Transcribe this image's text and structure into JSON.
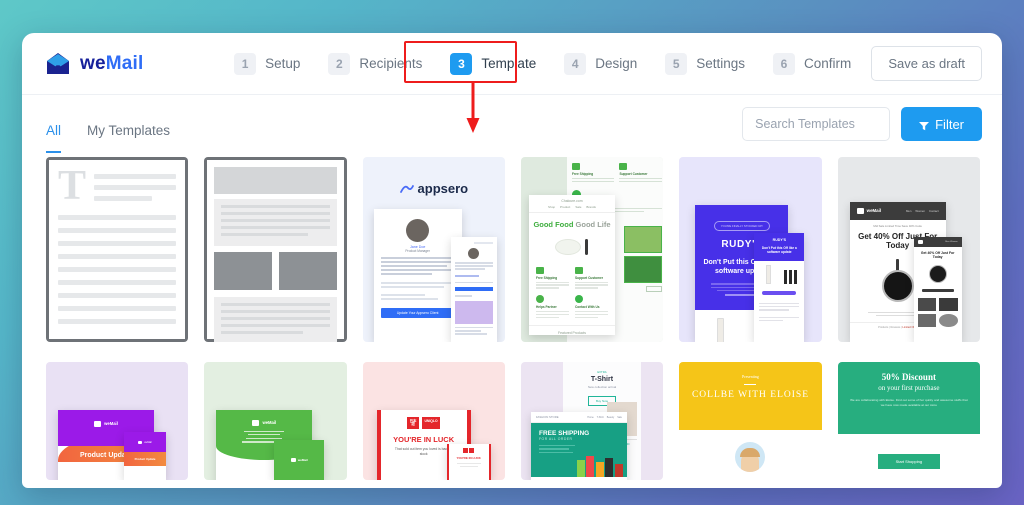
{
  "brand": {
    "name_we": "we",
    "name_mail": "Mail",
    "logo_icon": "envelope-icon"
  },
  "header": {
    "steps": [
      {
        "num": "1",
        "label": "Setup",
        "active": false
      },
      {
        "num": "2",
        "label": "Recipients",
        "active": false
      },
      {
        "num": "3",
        "label": "Template",
        "active": true
      },
      {
        "num": "4",
        "label": "Design",
        "active": false
      },
      {
        "num": "5",
        "label": "Settings",
        "active": false
      },
      {
        "num": "6",
        "label": "Confirm",
        "active": false
      }
    ],
    "save_draft_label": "Save as draft"
  },
  "toolbar": {
    "tabs": [
      {
        "label": "All",
        "active": true
      },
      {
        "label": "My Templates",
        "active": false
      }
    ],
    "search_placeholder": "Search Templates",
    "search_value": "",
    "filter_label": "Filter",
    "filter_icon": "funnel-icon"
  },
  "annotation": {
    "target_step": "Template",
    "box_color": "#ee1c1c",
    "arrow_icon": "down-arrow-icon"
  },
  "templates": {
    "row1": [
      {
        "id": "blank-text",
        "kind": "wireframe-text",
        "letter": "T"
      },
      {
        "id": "basic-layout",
        "kind": "wireframe-layout"
      },
      {
        "id": "appsero",
        "kind": "preview",
        "brand": "appsero",
        "person_name": "Jane Doe",
        "person_role": "Product Manager",
        "cta": "Update Your Appsero Client",
        "bg": "#eef2fb"
      },
      {
        "id": "good-food",
        "kind": "preview",
        "headline_a": "Good Food",
        "headline_b": "Good Life",
        "features": [
          "Free Shipping",
          "Support Customer",
          "Helps Partner",
          "Contact With Us"
        ],
        "section": "Featured Products",
        "footer": "Featured Products",
        "bg": "#dfeadf"
      },
      {
        "id": "rudys",
        "kind": "preview",
        "brand": "RUDY'S",
        "eyebrow": "YOU'RE FINALLY STOCKED UP!",
        "headline": "Don't Put this Off like a software update",
        "bg": "#e7e5fb"
      },
      {
        "id": "watch-sale",
        "kind": "preview",
        "brand": "weMail",
        "strip": "Mid Sale Limited Time Save 40% Code",
        "headline": "Get 40% Off Just For Today",
        "nav": [
          "Men",
          "Women",
          "Contact"
        ],
        "bg": "#e6e8ea"
      }
    ],
    "row2": [
      {
        "id": "product-update",
        "kind": "preview",
        "brand": "weMail",
        "headline": "Product Update",
        "bg": "#e9e1f4"
      },
      {
        "id": "green-card",
        "kind": "preview",
        "brand": "weMail",
        "bg": "#e3efe1"
      },
      {
        "id": "uniqlo-luck",
        "kind": "preview",
        "brand": "UNIQLO",
        "headline": "YOU'RE IN LUCK",
        "sub": "That sold out item you loved is back in stock",
        "bg": "#fbe3e3"
      },
      {
        "id": "free-shipping",
        "kind": "preview",
        "headline": "FREE SHIPPING",
        "sub": "FOR ALL ORDER",
        "side_title": "T-Shirt",
        "side_sub": "New collection arrival",
        "side_cta": "Buy Now",
        "bg": "#ece4f2"
      },
      {
        "id": "collbe-eloise",
        "kind": "preview",
        "eyebrow": "Presenting",
        "headline": "COLLBE WITH ELOISE",
        "bg": "#f5c518"
      },
      {
        "id": "discount-50",
        "kind": "preview",
        "headline": "50% Discount",
        "sub": "on your first purchase",
        "body": "We are collaborating with Eloise. Find out some of her quirky and awesome stuffs that we have now made available at our store",
        "cta": "Start Shopping",
        "bg": "#27ae7f"
      }
    ]
  }
}
